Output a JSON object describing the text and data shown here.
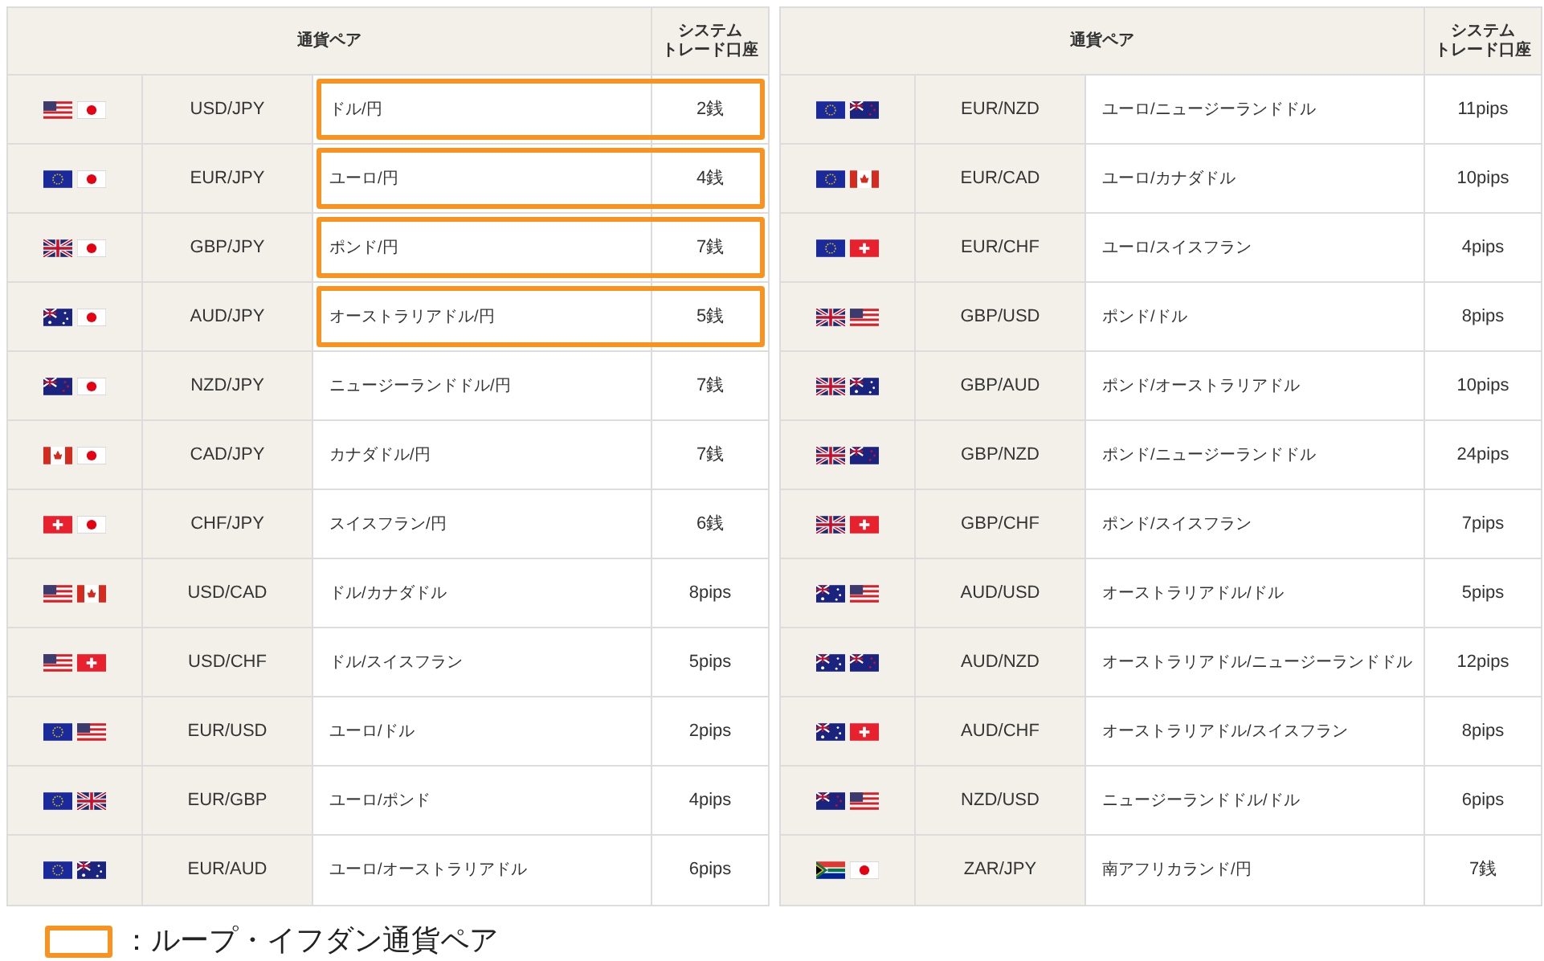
{
  "tables": [
    {
      "header": {
        "pair": "通貨ペア",
        "account": [
          "システム",
          "トレード口座"
        ]
      },
      "rows": [
        {
          "flags": [
            {
              "kind": "us"
            },
            {
              "kind": "jp"
            }
          ],
          "pair": "USD/JPY",
          "name": "ドル/円",
          "spread": "2銭",
          "loop": true
        },
        {
          "flags": [
            {
              "kind": "eu"
            },
            {
              "kind": "jp"
            }
          ],
          "pair": "EUR/JPY",
          "name": "ユーロ/円",
          "spread": "4銭",
          "loop": true
        },
        {
          "flags": [
            {
              "kind": "gb"
            },
            {
              "kind": "jp"
            }
          ],
          "pair": "GBP/JPY",
          "name": "ポンド/円",
          "spread": "7銭",
          "loop": true
        },
        {
          "flags": [
            {
              "kind": "au"
            },
            {
              "kind": "jp"
            }
          ],
          "pair": "AUD/JPY",
          "name": "オーストラリアドル/円",
          "spread": "5銭",
          "loop": true
        },
        {
          "flags": [
            {
              "kind": "nz"
            },
            {
              "kind": "jp"
            }
          ],
          "pair": "NZD/JPY",
          "name": "ニュージーランドドル/円",
          "spread": "7銭",
          "loop": false
        },
        {
          "flags": [
            {
              "kind": "ca"
            },
            {
              "kind": "jp"
            }
          ],
          "pair": "CAD/JPY",
          "name": "カナダドル/円",
          "spread": "7銭",
          "loop": false
        },
        {
          "flags": [
            {
              "kind": "ch"
            },
            {
              "kind": "jp"
            }
          ],
          "pair": "CHF/JPY",
          "name": "スイスフラン/円",
          "spread": "6銭",
          "loop": false
        },
        {
          "flags": [
            {
              "kind": "us"
            },
            {
              "kind": "ca"
            }
          ],
          "pair": "USD/CAD",
          "name": "ドル/カナダドル",
          "spread": "8pips",
          "loop": false
        },
        {
          "flags": [
            {
              "kind": "us"
            },
            {
              "kind": "ch"
            }
          ],
          "pair": "USD/CHF",
          "name": "ドル/スイスフラン",
          "spread": "5pips",
          "loop": false
        },
        {
          "flags": [
            {
              "kind": "eu"
            },
            {
              "kind": "us"
            }
          ],
          "pair": "EUR/USD",
          "name": "ユーロ/ドル",
          "spread": "2pips",
          "loop": false
        },
        {
          "flags": [
            {
              "kind": "eu"
            },
            {
              "kind": "gb"
            }
          ],
          "pair": "EUR/GBP",
          "name": "ユーロ/ポンド",
          "spread": "4pips",
          "loop": false
        },
        {
          "flags": [
            {
              "kind": "eu"
            },
            {
              "kind": "au"
            }
          ],
          "pair": "EUR/AUD",
          "name": "ユーロ/オーストラリアドル",
          "spread": "6pips",
          "loop": false
        }
      ]
    },
    {
      "header": {
        "pair": "通貨ペア",
        "account": [
          "システム",
          "トレード口座"
        ]
      },
      "rows": [
        {
          "flags": [
            {
              "kind": "eu"
            },
            {
              "kind": "nz"
            }
          ],
          "pair": "EUR/NZD",
          "name": "ユーロ/ニュージーランドドル",
          "spread": "11pips",
          "loop": false
        },
        {
          "flags": [
            {
              "kind": "eu"
            },
            {
              "kind": "ca"
            }
          ],
          "pair": "EUR/CAD",
          "name": "ユーロ/カナダドル",
          "spread": "10pips",
          "loop": false
        },
        {
          "flags": [
            {
              "kind": "eu"
            },
            {
              "kind": "ch"
            }
          ],
          "pair": "EUR/CHF",
          "name": "ユーロ/スイスフラン",
          "spread": "4pips",
          "loop": false
        },
        {
          "flags": [
            {
              "kind": "gb"
            },
            {
              "kind": "us"
            }
          ],
          "pair": "GBP/USD",
          "name": "ポンド/ドル",
          "spread": "8pips",
          "loop": false
        },
        {
          "flags": [
            {
              "kind": "gb"
            },
            {
              "kind": "au"
            }
          ],
          "pair": "GBP/AUD",
          "name": "ポンド/オーストラリアドル",
          "spread": "10pips",
          "loop": false
        },
        {
          "flags": [
            {
              "kind": "gb"
            },
            {
              "kind": "nz"
            }
          ],
          "pair": "GBP/NZD",
          "name": "ポンド/ニュージーランドドル",
          "spread": "24pips",
          "loop": false
        },
        {
          "flags": [
            {
              "kind": "gb"
            },
            {
              "kind": "ch"
            }
          ],
          "pair": "GBP/CHF",
          "name": "ポンド/スイスフラン",
          "spread": "7pips",
          "loop": false
        },
        {
          "flags": [
            {
              "kind": "au"
            },
            {
              "kind": "us"
            }
          ],
          "pair": "AUD/USD",
          "name": "オーストラリアドル/ドル",
          "spread": "5pips",
          "loop": false
        },
        {
          "flags": [
            {
              "kind": "au"
            },
            {
              "kind": "nz"
            }
          ],
          "pair": "AUD/NZD",
          "name": "オーストラリアドル/ニュージーランドドル",
          "spread": "12pips",
          "loop": false
        },
        {
          "flags": [
            {
              "kind": "au"
            },
            {
              "kind": "ch"
            }
          ],
          "pair": "AUD/CHF",
          "name": "オーストラリアドル/スイスフラン",
          "spread": "8pips",
          "loop": false
        },
        {
          "flags": [
            {
              "kind": "nz"
            },
            {
              "kind": "us"
            }
          ],
          "pair": "NZD/USD",
          "name": "ニュージーランドドル/ドル",
          "spread": "6pips",
          "loop": false
        },
        {
          "flags": [
            {
              "kind": "za"
            },
            {
              "kind": "jp"
            }
          ],
          "pair": "ZAR/JPY",
          "name": "南アフリカランド/円",
          "spread": "7銭",
          "loop": false
        }
      ]
    }
  ],
  "legend": {
    "text": "：ループ・イフダン通貨ペア"
  }
}
